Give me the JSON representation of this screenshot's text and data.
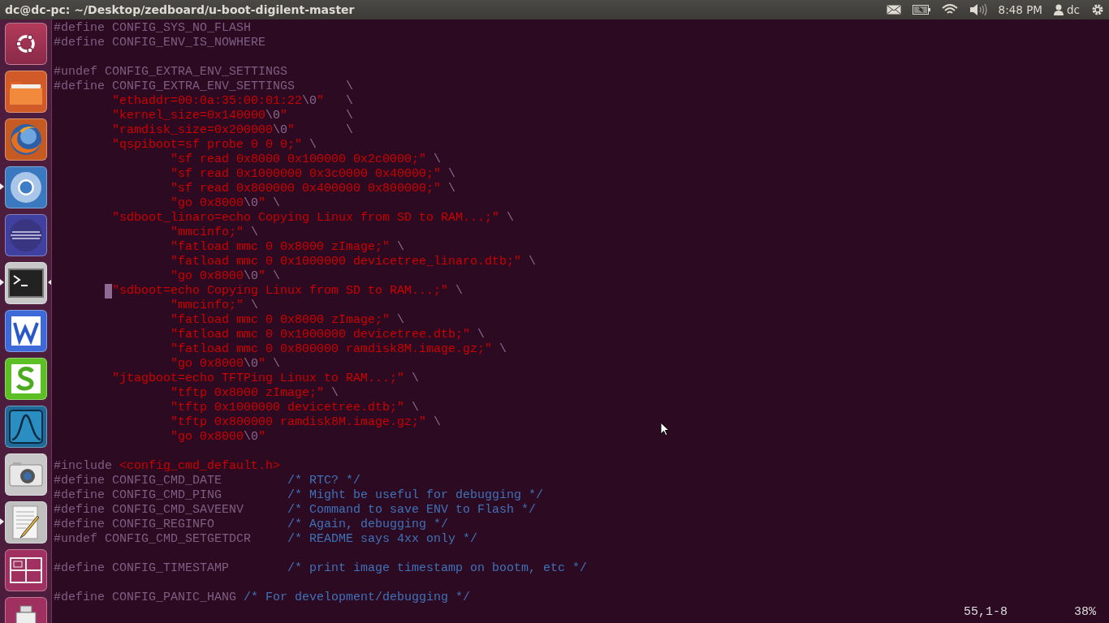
{
  "top_bar": {
    "title": "dc@dc-pc: ~/Desktop/zedboard/u-boot-digilent-master",
    "clock": "8:48 PM",
    "user": "dc"
  },
  "launcher": {
    "items": [
      {
        "kind": "ubuntu",
        "running": false,
        "focused": false
      },
      {
        "kind": "files",
        "running": false,
        "focused": false
      },
      {
        "kind": "firefox",
        "running": false,
        "focused": false
      },
      {
        "kind": "chromium",
        "running": true,
        "focused": false
      },
      {
        "kind": "eclipse",
        "running": false,
        "focused": false
      },
      {
        "kind": "terminal",
        "running": true,
        "focused": true
      },
      {
        "kind": "writer",
        "running": false,
        "focused": false
      },
      {
        "kind": "calc",
        "running": false,
        "focused": false
      },
      {
        "kind": "wireshark",
        "running": false,
        "focused": false
      },
      {
        "kind": "camera",
        "running": false,
        "focused": false
      },
      {
        "kind": "editor",
        "running": true,
        "focused": false
      },
      {
        "kind": "workspaces",
        "running": false,
        "focused": false
      },
      {
        "kind": "usb",
        "running": false,
        "focused": false
      }
    ]
  },
  "editor": {
    "lines": [
      {
        "kind": "top",
        "segments": [
          {
            "kind": "preproc",
            "text": "#define CONFIG_SYS_NO_FLASH"
          }
        ]
      },
      {
        "kind": "top",
        "segments": [
          {
            "kind": "preproc",
            "text": "#define CONFIG_ENV_IS_NOWHERE"
          }
        ]
      },
      {
        "kind": "blank"
      },
      {
        "kind": "top",
        "segments": [
          {
            "kind": "preproc",
            "text": "#undef CONFIG_EXTRA_ENV_SETTINGS"
          }
        ]
      },
      {
        "kind": "top",
        "segments": [
          {
            "kind": "preproc",
            "text": "#define CONFIG_EXTRA_ENV_SETTINGS"
          },
          {
            "kind": "aligned-continuation",
            "text": "\\"
          }
        ]
      },
      {
        "kind": "nested",
        "segments": [
          {
            "kind": "string",
            "text": "\"ethaddr=00:0a:35:00:01:22"
          },
          {
            "kind": "escape",
            "text": "\\0"
          },
          {
            "kind": "string",
            "text": "\""
          },
          {
            "kind": "aligned-continuation",
            "text": "\\"
          }
        ]
      },
      {
        "kind": "nested",
        "segments": [
          {
            "kind": "string",
            "text": "\"kernel_size=0x140000"
          },
          {
            "kind": "escape",
            "text": "\\0"
          },
          {
            "kind": "string",
            "text": "\""
          },
          {
            "kind": "aligned-continuation",
            "text": "\\"
          }
        ]
      },
      {
        "kind": "nested",
        "segments": [
          {
            "kind": "string",
            "text": "\"ramdisk_size=0x200000"
          },
          {
            "kind": "escape",
            "text": "\\0"
          },
          {
            "kind": "string",
            "text": "\""
          },
          {
            "kind": "aligned-continuation",
            "text": "\\"
          }
        ]
      },
      {
        "kind": "nested",
        "segments": [
          {
            "kind": "string",
            "text": "\"qspiboot=sf probe 0 0 0;\""
          },
          {
            "kind": "continuation",
            "text": "\\"
          }
        ]
      },
      {
        "kind": "deep",
        "segments": [
          {
            "kind": "string",
            "text": "\"sf read 0x8000 0x100000 0x2c0000;\""
          },
          {
            "kind": "continuation",
            "text": "\\"
          }
        ]
      },
      {
        "kind": "deep",
        "segments": [
          {
            "kind": "string",
            "text": "\"sf read 0x1000000 0x3c0000 0x40000;\""
          },
          {
            "kind": "continuation",
            "text": "\\"
          }
        ]
      },
      {
        "kind": "deep",
        "segments": [
          {
            "kind": "string",
            "text": "\"sf read 0x800000 0x400000 0x800000;\""
          },
          {
            "kind": "continuation",
            "text": "\\"
          }
        ]
      },
      {
        "kind": "deep",
        "segments": [
          {
            "kind": "string",
            "text": "\"go 0x8000"
          },
          {
            "kind": "escape",
            "text": "\\0"
          },
          {
            "kind": "string",
            "text": "\""
          },
          {
            "kind": "continuation",
            "text": "\\"
          }
        ]
      },
      {
        "kind": "nested",
        "segments": [
          {
            "kind": "string",
            "text": "\"sdboot_linaro=echo Copying Linux from SD to RAM...;\""
          },
          {
            "kind": "continuation",
            "text": "\\"
          }
        ]
      },
      {
        "kind": "deep",
        "segments": [
          {
            "kind": "string",
            "text": "\"mmcinfo;\""
          },
          {
            "kind": "continuation",
            "text": "\\"
          }
        ]
      },
      {
        "kind": "deep",
        "segments": [
          {
            "kind": "string",
            "text": "\"fatload mmc 0 0x8000 zImage;\""
          },
          {
            "kind": "continuation",
            "text": "\\"
          }
        ]
      },
      {
        "kind": "deep",
        "segments": [
          {
            "kind": "string",
            "text": "\"fatload mmc 0 0x1000000 devicetree_linaro.dtb;\""
          },
          {
            "kind": "continuation",
            "text": "\\"
          }
        ]
      },
      {
        "kind": "deep",
        "segments": [
          {
            "kind": "string",
            "text": "\"go 0x8000"
          },
          {
            "kind": "escape",
            "text": "\\0"
          },
          {
            "kind": "string",
            "text": "\""
          },
          {
            "kind": "continuation",
            "text": "\\"
          }
        ]
      },
      {
        "kind": "nested",
        "cursor": true,
        "segments": [
          {
            "kind": "string",
            "text": "\"sdboot=echo Copying Linux from SD to RAM...;\""
          },
          {
            "kind": "continuation",
            "text": "\\"
          }
        ]
      },
      {
        "kind": "deep",
        "segments": [
          {
            "kind": "string",
            "text": "\"mmcinfo;\""
          },
          {
            "kind": "continuation",
            "text": "\\"
          }
        ]
      },
      {
        "kind": "deep",
        "segments": [
          {
            "kind": "string",
            "text": "\"fatload mmc 0 0x8000 zImage;\""
          },
          {
            "kind": "continuation",
            "text": "\\"
          }
        ]
      },
      {
        "kind": "deep",
        "segments": [
          {
            "kind": "string",
            "text": "\"fatload mmc 0 0x1000000 devicetree.dtb;\""
          },
          {
            "kind": "continuation",
            "text": "\\"
          }
        ]
      },
      {
        "kind": "deep",
        "segments": [
          {
            "kind": "string",
            "text": "\"fatload mmc 0 0x800000 ramdisk8M.image.gz;\""
          },
          {
            "kind": "continuation",
            "text": "\\"
          }
        ]
      },
      {
        "kind": "deep",
        "segments": [
          {
            "kind": "string",
            "text": "\"go 0x8000"
          },
          {
            "kind": "escape",
            "text": "\\0"
          },
          {
            "kind": "string",
            "text": "\""
          },
          {
            "kind": "continuation",
            "text": "\\"
          }
        ]
      },
      {
        "kind": "nested",
        "segments": [
          {
            "kind": "string",
            "text": "\"jtagboot=echo TFTPing Linux to RAM...;\""
          },
          {
            "kind": "continuation",
            "text": "\\"
          }
        ]
      },
      {
        "kind": "deep",
        "segments": [
          {
            "kind": "string",
            "text": "\"tftp 0x8000 zImage;\""
          },
          {
            "kind": "continuation",
            "text": "\\"
          }
        ]
      },
      {
        "kind": "deep",
        "segments": [
          {
            "kind": "string",
            "text": "\"tftp 0x1000000 devicetree.dtb;\""
          },
          {
            "kind": "continuation",
            "text": "\\"
          }
        ]
      },
      {
        "kind": "deep",
        "segments": [
          {
            "kind": "string",
            "text": "\"tftp 0x800000 ramdisk8M.image.gz;\""
          },
          {
            "kind": "continuation",
            "text": "\\"
          }
        ]
      },
      {
        "kind": "deep",
        "segments": [
          {
            "kind": "string",
            "text": "\"go 0x8000"
          },
          {
            "kind": "escape",
            "text": "\\0"
          },
          {
            "kind": "string",
            "text": "\""
          }
        ]
      },
      {
        "kind": "blank"
      },
      {
        "kind": "top",
        "segments": [
          {
            "kind": "preproc",
            "text": "#include"
          },
          {
            "kind": "include-path",
            "text": "<config_cmd_default.h>"
          }
        ]
      },
      {
        "kind": "top",
        "segments": [
          {
            "kind": "preproc",
            "text": "#define CONFIG_CMD_DATE"
          },
          {
            "kind": "aligned-comment",
            "text": "/* RTC? */"
          }
        ]
      },
      {
        "kind": "top",
        "segments": [
          {
            "kind": "preproc",
            "text": "#define CONFIG_CMD_PING"
          },
          {
            "kind": "aligned-comment",
            "text": "/* Might be useful for debugging */"
          }
        ]
      },
      {
        "kind": "top",
        "segments": [
          {
            "kind": "preproc",
            "text": "#define CONFIG_CMD_SAVEENV"
          },
          {
            "kind": "aligned-comment",
            "text": "/* Command to save ENV to Flash */"
          }
        ]
      },
      {
        "kind": "top",
        "segments": [
          {
            "kind": "preproc",
            "text": "#define CONFIG_REGINFO"
          },
          {
            "kind": "aligned-comment",
            "text": "/* Again, debugging */"
          }
        ]
      },
      {
        "kind": "top",
        "segments": [
          {
            "kind": "preproc",
            "text": "#undef CONFIG_CMD_SETGETDCR"
          },
          {
            "kind": "aligned-comment",
            "text": "/* README says 4xx only */"
          }
        ]
      },
      {
        "kind": "blank"
      },
      {
        "kind": "top",
        "segments": [
          {
            "kind": "preproc",
            "text": "#define CONFIG_TIMESTAMP"
          },
          {
            "kind": "aligned-comment",
            "text": "/* print image timestamp on bootm, etc */"
          }
        ]
      },
      {
        "kind": "blank"
      },
      {
        "kind": "top",
        "segments": [
          {
            "kind": "preproc",
            "text": "#define CONFIG_PANIC_HANG"
          },
          {
            "kind": "comment",
            "text": "/* For development/debugging */"
          }
        ]
      }
    ]
  },
  "status_line": {
    "position": "55,1-8",
    "scroll": "38%"
  }
}
